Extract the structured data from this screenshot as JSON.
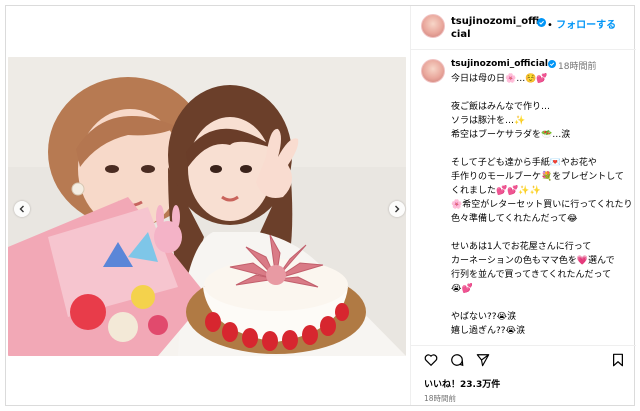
{
  "account": {
    "username_display": "tsujinozomi_official",
    "follow_label": "フォローする"
  },
  "caption": {
    "username": "tsujinozomi_official",
    "time": "18時間前",
    "text": "今日は母の日🌸…☺️💕\n\n夜ご飯はみんなで作り…\nソラは豚汁を…✨\n希空はブーケサラダを🥗…涙\n\nそして子ども達から手紙💌やお花や\n手作りのモールブーケ💐をプレゼントして\nくれました💕💕✨✨\n🌸希空がレターセット買いに行ってくれたり\n色々準備してくれたんだって😂\n\nせいあは1人でお花屋さんに行って\nカーネーションの色もママ色を💗選んで\n行列を並んで買ってきてくれたんだって\n😭💕\n\nやばない??😭涙\n嬉し過ぎん??😭涙\n\nそして希空は数日前からモールブーケ💐"
  },
  "footer": {
    "likes": "いいね！23.3万件",
    "posted": "18時間前"
  },
  "icons": {
    "prev": "chevron-left-icon",
    "next": "chevron-right-icon",
    "like": "heart-icon",
    "comment": "comment-icon",
    "share": "share-icon",
    "save": "bookmark-icon",
    "verified": "verified-badge-icon"
  },
  "colors": {
    "follow": "#0095f6",
    "verified": "#0095f6",
    "muted": "#737373"
  }
}
